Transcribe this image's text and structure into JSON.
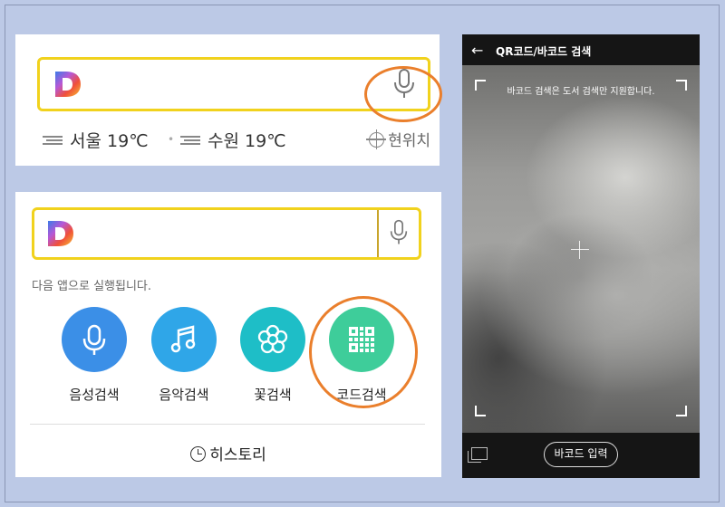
{
  "panel_search": {
    "weather": [
      {
        "city": "서울",
        "temp": "19℃",
        "icon": "fog-icon"
      },
      {
        "city": "수원",
        "temp": "19℃",
        "icon": "fog-icon"
      }
    ],
    "location_label": "현위치"
  },
  "panel_apps": {
    "description": "다음 앱으로 실행됩니다.",
    "buttons": [
      {
        "label": "음성검색",
        "icon": "mic-icon",
        "color": "#3b8fe7"
      },
      {
        "label": "음악검색",
        "icon": "music-note-icon",
        "color": "#2fa6e8"
      },
      {
        "label": "꽃검색",
        "icon": "flower-icon",
        "color": "#1ebec7"
      },
      {
        "label": "코드검색",
        "icon": "qr-code-icon",
        "color": "#3ecd9a"
      }
    ],
    "history_label": "히스토리"
  },
  "panel_scanner": {
    "title": "QR코드/바코드 검색",
    "notice": "바코드 검색은 도서 검색만 지원합니다.",
    "barcode_button": "바코드 입력"
  },
  "colors": {
    "search_border": "#f1d21d",
    "highlight_ring": "#ea7f2c",
    "background": "#bcc9e6"
  }
}
